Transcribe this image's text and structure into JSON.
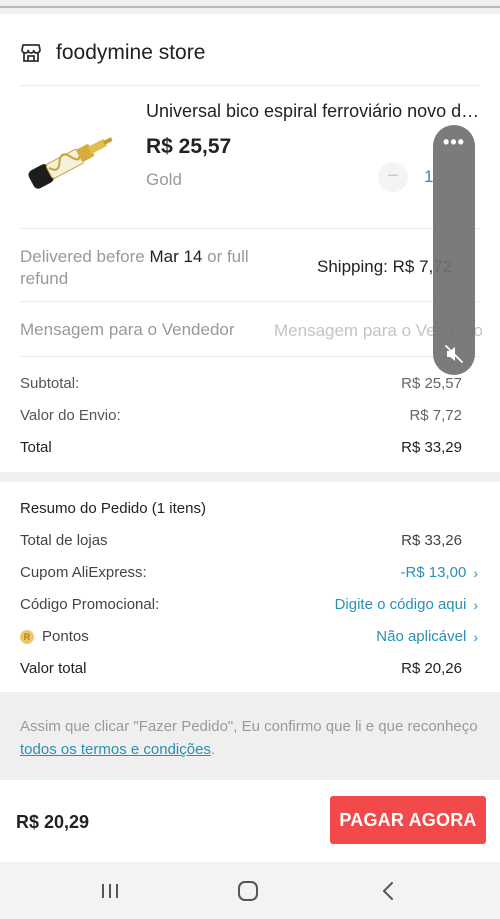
{
  "store": {
    "name": "foodymine store",
    "icon": "store-icon"
  },
  "product": {
    "title": "Universal bico espiral ferroviário novo de latão",
    "price": "R$ 25,57",
    "variant": "Gold",
    "qty_minus": "−",
    "qty": "1"
  },
  "delivery": {
    "prefix": "Delivered before ",
    "date": "Mar 14",
    "suffix": " or full refund",
    "shipping": "Shipping: R$ 7,72"
  },
  "message": {
    "label": "Mensagem para o Vendedor",
    "placeholder": "Mensagem para o Vendedor"
  },
  "summary": {
    "subtotal_label": "Subtotal:",
    "subtotal_value": "R$ 25,57",
    "shipping_label": "Valor do Envio:",
    "shipping_value": "R$ 7,72",
    "total_label": "Total",
    "total_value": "R$ 33,29"
  },
  "order": {
    "title": "Resumo do Pedido (1 itens)",
    "stores_label": "Total de lojas",
    "stores_value": "R$ 33,26",
    "coupon_label": "Cupom AliExpress:",
    "coupon_value": "-R$ 13,00",
    "promo_label": "Código Promocional:",
    "promo_value": "Digite o código aqui",
    "points_badge": "R",
    "points_label": "Pontos",
    "points_value": "Não aplicável",
    "total_label": "Valor total",
    "total_value": "R$ 20,26",
    "chevron": "›"
  },
  "terms": {
    "text": "Assim que clicar \"Fazer Pedido\", Eu confirmo que li e que reconheço ",
    "link": "todos os termos e condições",
    "end": "."
  },
  "pay": {
    "amount": "R$ 20,29",
    "button": "PAGAR AGORA"
  },
  "floating": {
    "dots": "•••"
  },
  "colors": {
    "accent_link": "#2a8fb6",
    "pay_button": "#f24a4a"
  }
}
